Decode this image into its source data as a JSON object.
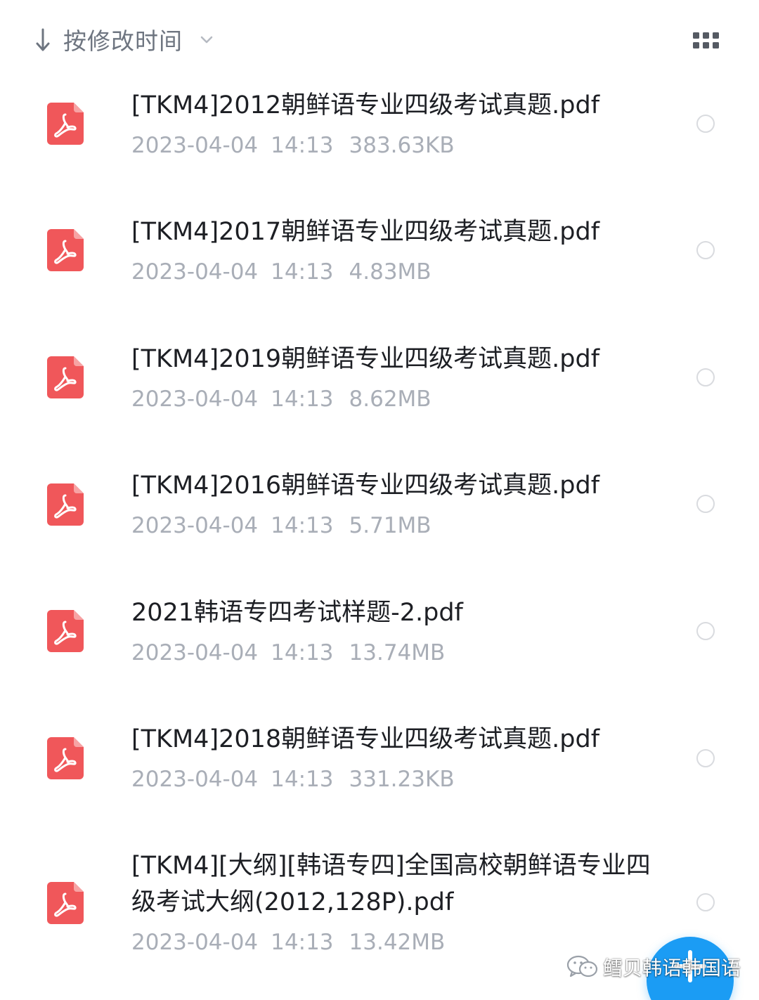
{
  "sort": {
    "label": "按修改时间",
    "direction_icon": "arrow-down-icon",
    "dropdown_icon": "chevron-down-icon"
  },
  "view_toggle": {
    "icon": "grid-icon"
  },
  "files": [
    {
      "name": "[TKM4]2012朝鲜语专业四级考试真题.pdf",
      "date": "2023-04-04",
      "time": "14:13",
      "size": "383.63KB",
      "icon": "pdf-file-icon"
    },
    {
      "name": "[TKM4]2017朝鲜语专业四级考试真题.pdf",
      "date": "2023-04-04",
      "time": "14:13",
      "size": "4.83MB",
      "icon": "pdf-file-icon"
    },
    {
      "name": "[TKM4]2019朝鲜语专业四级考试真题.pdf",
      "date": "2023-04-04",
      "time": "14:13",
      "size": "8.62MB",
      "icon": "pdf-file-icon"
    },
    {
      "name": "[TKM4]2016朝鲜语专业四级考试真题.pdf",
      "date": "2023-04-04",
      "time": "14:13",
      "size": "5.71MB",
      "icon": "pdf-file-icon"
    },
    {
      "name": "2021韩语专四考试样题-2.pdf",
      "date": "2023-04-04",
      "time": "14:13",
      "size": "13.74MB",
      "icon": "pdf-file-icon"
    },
    {
      "name": "[TKM4]2018朝鲜语专业四级考试真题.pdf",
      "date": "2023-04-04",
      "time": "14:13",
      "size": "331.23KB",
      "icon": "pdf-file-icon"
    },
    {
      "name": "[TKM4][大纲][韩语专四]全国高校朝鲜语专业四级考试大纲(2012,128P).pdf",
      "date": "2023-04-04",
      "time": "14:13",
      "size": "13.42MB",
      "icon": "pdf-file-icon"
    }
  ],
  "fab": {
    "icon": "plus-icon"
  },
  "watermark": {
    "text": "鳕贝韩语韩国语",
    "icon": "wechat-icon"
  },
  "colors": {
    "pdf_icon": "#f0575a",
    "fab": "#1b9cf4",
    "meta_text": "#a9aeb7",
    "title_text": "#1d1f24",
    "sort_text": "#6e7580"
  }
}
